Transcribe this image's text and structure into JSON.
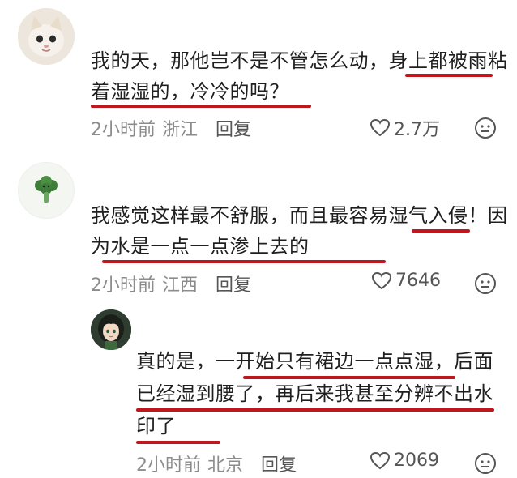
{
  "comments": [
    {
      "avatar_icon": "cat-avatar-icon",
      "text": "我的天，那他岂不是不管怎么动，身上都被雨粘着湿湿的，冷冷的吗？",
      "time": "2小时前",
      "location": "浙江",
      "reply_label": "回复",
      "likes": "2.7万"
    },
    {
      "avatar_icon": "broccoli-avatar-icon",
      "text": "我感觉这样最不舒服，而且最容易湿气入侵！因为水是一点一点渗上去的",
      "time": "2小时前",
      "location": "江西",
      "reply_label": "回复",
      "likes": "7646"
    },
    {
      "avatar_icon": "anime-girl-avatar-icon",
      "text": "真的是，一开始只有裙边一点点湿，后面已经湿到腰了，再后来我甚至分辨不出水印了",
      "time": "2小时前",
      "location": "北京",
      "reply_label": "回复",
      "likes": "2069"
    }
  ],
  "colors": {
    "underline": "#c0171f",
    "meta_text": "#8c8c8c",
    "body_text": "#1f1f1f"
  }
}
